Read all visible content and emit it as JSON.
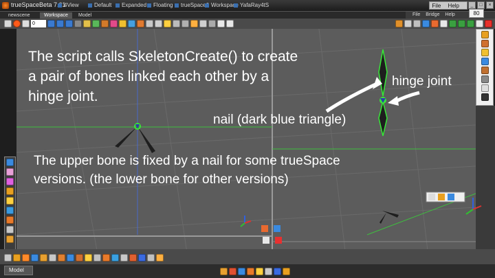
{
  "window": {
    "title": "trueSpaceBeta 7.61",
    "top_tabs": [
      "4View",
      "Default",
      "Expanded",
      "Floating",
      "trueSpace6",
      "Workspace",
      "YafaRay4tS"
    ],
    "menu": [
      "File",
      "Help"
    ],
    "controls": [
      "minimize",
      "maximize",
      "close"
    ]
  },
  "doc_tabs": {
    "scene": "newscene",
    "active": "Workspace",
    "other": "Model"
  },
  "right_menu": [
    "File",
    "Bridge",
    "Help"
  ],
  "zoom": "80",
  "toolbar": {
    "frame_field": "0"
  },
  "viewport": {
    "annotations": {
      "caption_line1": "The script calls SkeletonCreate() to create",
      "caption_line2": "a pair of bones linked each other by a",
      "caption_line3": "hinge joint.",
      "nail_label": "nail (dark blue triangle)",
      "hinge_label": "hinge joint",
      "upper_caption_line1": "The upper  bone is fixed by a nail for some trueSpace",
      "upper_caption_line2": "versions.  (the lower bone for other versions)"
    },
    "bone_color": "#1e1e1e",
    "joint_color": "#38e838",
    "arrow_color": "#ffffff"
  },
  "statusbar": {
    "model_tab": "Model"
  },
  "colors": {
    "viewport_bg": "#5c5c5c",
    "grid": "#6a6a6a",
    "axis_green": "#3ec13e",
    "axis_blue": "#4a6ac8"
  }
}
